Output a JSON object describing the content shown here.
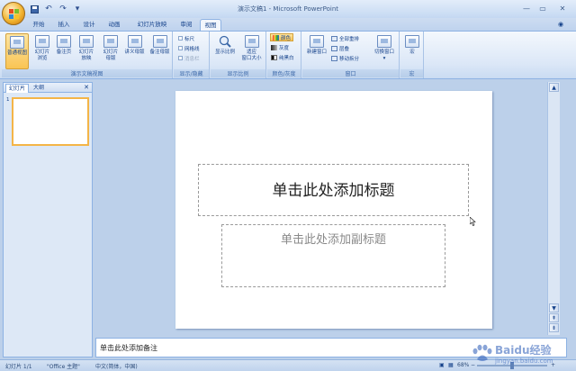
{
  "app": {
    "title": "演示文稿1 - Microsoft PowerPoint"
  },
  "tabs": [
    {
      "label": "开始"
    },
    {
      "label": "插入"
    },
    {
      "label": "设计"
    },
    {
      "label": "动画"
    },
    {
      "label": "幻灯片放映"
    },
    {
      "label": "审阅"
    },
    {
      "label": "视图"
    }
  ],
  "ribbon": {
    "groups": {
      "presentation_views": "演示文稿视图",
      "show_hide": "显示/隐藏",
      "zoom": "显示比例",
      "color": "颜色/灰度",
      "window": "窗口",
      "macro": "宏"
    },
    "buttons": {
      "normal": "普通视图",
      "slide_sorter_1": "幻灯片",
      "slide_sorter_2": "浏览",
      "notes_page": "备注页",
      "slideshow_1": "幻灯片",
      "slideshow_2": "放映",
      "slide_master_1": "幻灯片",
      "slide_master_2": "母版",
      "handout_master": "讲义母版",
      "notes_master": "备注母版",
      "ruler": "标尺",
      "gridlines": "网格线",
      "message_bar": "消息栏",
      "zoom": "显示比例",
      "fit_1": "适应",
      "fit_2": "窗口大小",
      "color": "颜色",
      "grayscale": "灰度",
      "pure_bw": "纯黑白",
      "new_window": "新建窗口",
      "arrange_all": "全部重排",
      "cascade": "层叠",
      "move_split": "移动拆分",
      "switch_window": "切换窗口",
      "macro": "宏"
    }
  },
  "left_pane": {
    "tab_slides": "幻灯片",
    "tab_outline": "大纲",
    "slide_number": "1"
  },
  "slide": {
    "title_placeholder": "单击此处添加标题",
    "subtitle_placeholder": "单击此处添加副标题"
  },
  "notes": {
    "placeholder": "单击此处添加备注"
  },
  "status": {
    "slide_pos": "幻灯片 1/1",
    "theme": "\"Office 主题\"",
    "language": "中文(简体，中国)",
    "zoom": "68%"
  },
  "watermark": {
    "brand": "Baidu经验",
    "url": "jingyan.baidu.com"
  },
  "colors": {
    "accent": "#15428b",
    "selected": "#f9c454"
  }
}
